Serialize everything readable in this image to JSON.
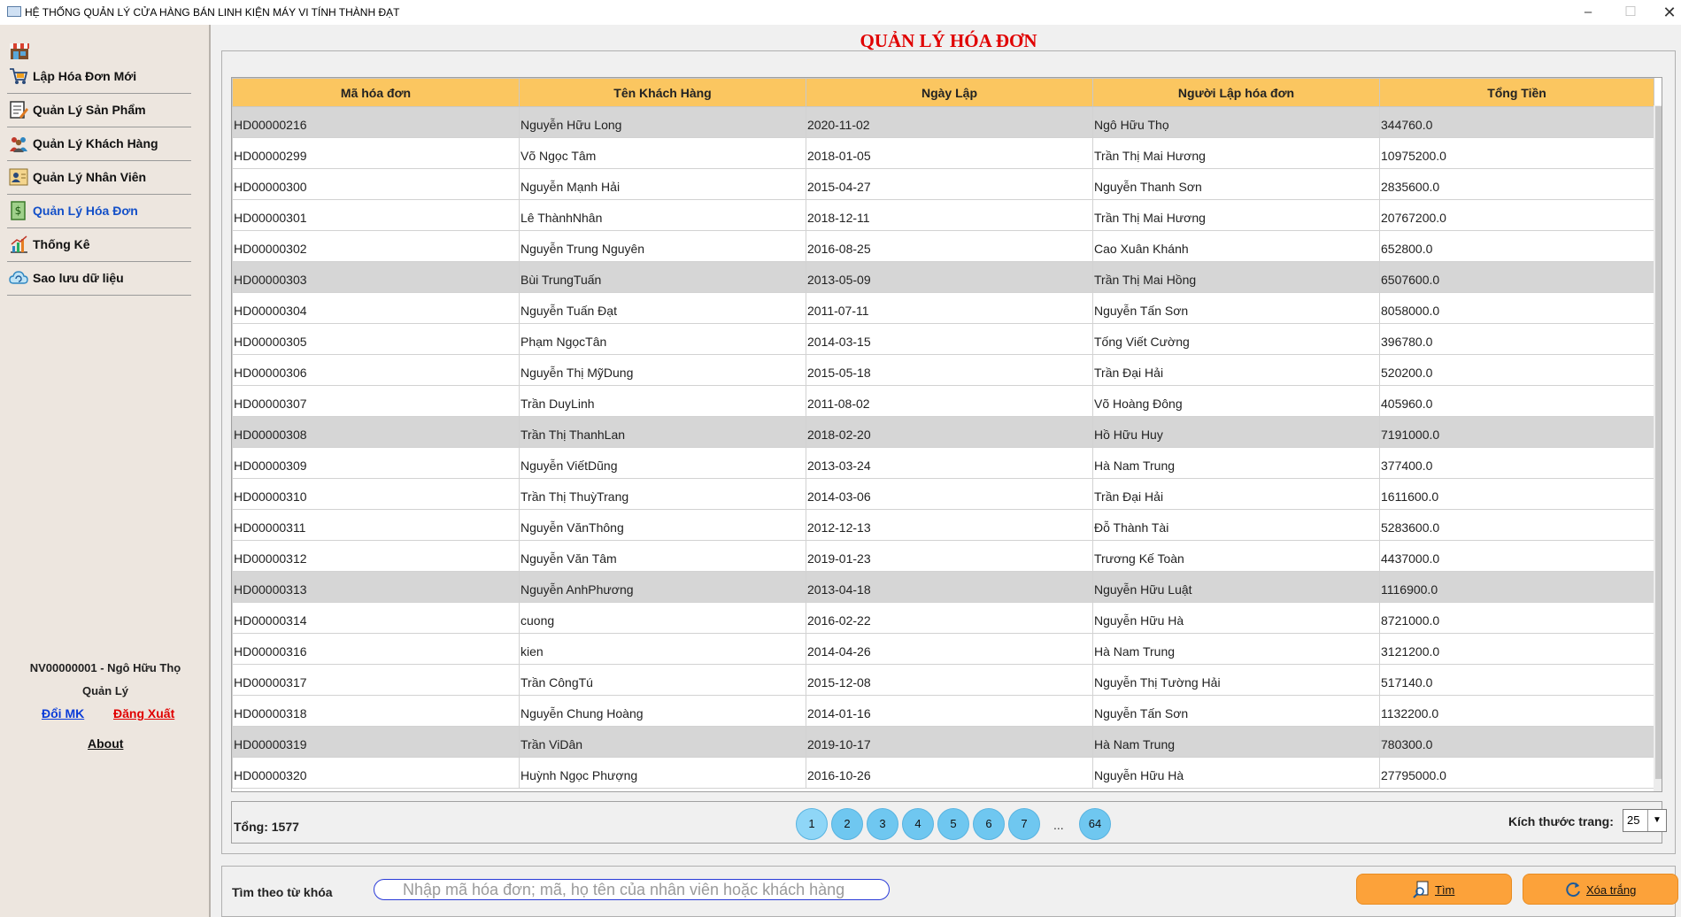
{
  "window": {
    "title": "HỆ THỐNG QUẢN LÝ CỬA HÀNG BÁN LINH KIỆN MÁY VI TÍNH THÀNH ĐẠT",
    "minimize": "–",
    "maximize": "☐",
    "close": "✕"
  },
  "sidebar": {
    "items": [
      {
        "label": "Lập Hóa Đơn Mới",
        "icon": "cart-icon"
      },
      {
        "label": "Quản Lý Sản Phẩm",
        "icon": "edit-list-icon"
      },
      {
        "label": "Quản Lý Khách Hàng",
        "icon": "customers-icon"
      },
      {
        "label": "Quản Lý Nhân Viên",
        "icon": "employee-icon"
      },
      {
        "label": "Quản Lý Hóa Đơn",
        "icon": "invoice-icon"
      },
      {
        "label": "Thống Kê",
        "icon": "chart-icon"
      },
      {
        "label": "Sao lưu dữ liệu",
        "icon": "backup-icon"
      }
    ],
    "active_index": 4,
    "user": "NV00000001 - Ngô Hữu  Thọ",
    "role": "Quản Lý",
    "change_password": "Đổi MK",
    "logout": "Đăng Xuất",
    "about": "About"
  },
  "main": {
    "title": "QUẢN LÝ HÓA ĐƠN",
    "columns": [
      "Mã hóa đơn",
      "Tên Khách Hàng",
      "Ngày Lập",
      "Người Lập hóa đơn",
      "Tổng Tiền"
    ],
    "rows": [
      [
        "HD00000216",
        "Nguyễn Hữu Long",
        "2020-11-02",
        "Ngô Hữu  Thọ",
        "344760.0"
      ],
      [
        "HD00000299",
        "Võ Ngọc Tâm",
        "2018-01-05",
        "Trần Thị Mai Hương",
        "10975200.0"
      ],
      [
        "HD00000300",
        "Nguyễn Mạnh Hải",
        "2015-04-27",
        "Nguyễn Thanh Sơn",
        "2835600.0"
      ],
      [
        "HD00000301",
        "Lê ThànhNhân",
        "2018-12-11",
        "Trần Thị Mai Hương",
        "20767200.0"
      ],
      [
        "HD00000302",
        "Nguyễn Trung Nguyên",
        "2016-08-25",
        "Cao Xuân  Khánh",
        "652800.0"
      ],
      [
        "HD00000303",
        "Bùi TrungTuấn",
        "2013-05-09",
        "Trần Thị Mai Hồng",
        "6507600.0"
      ],
      [
        "HD00000304",
        "Nguyễn Tuấn Đạt",
        "2011-07-11",
        "Nguyễn Tấn Sơn",
        "8058000.0"
      ],
      [
        "HD00000305",
        "Phạm NgọcTân",
        "2014-03-15",
        "Tống Viết Cường",
        "396780.0"
      ],
      [
        "HD00000306",
        "Nguyễn Thị MỹDung",
        "2015-05-18",
        "Trần Đại Hải",
        "520200.0"
      ],
      [
        "HD00000307",
        "Trần DuyLinh",
        "2011-08-02",
        "Võ Hoàng Đông",
        "405960.0"
      ],
      [
        "HD00000308",
        "Trần Thị ThanhLan",
        "2018-02-20",
        "Hồ Hữu  Huy",
        "7191000.0"
      ],
      [
        "HD00000309",
        "Nguyễn ViếtDũng",
        "2013-03-24",
        "Hà Nam  Trung",
        "377400.0"
      ],
      [
        "HD00000310",
        "Trần Thị ThuỳTrang",
        "2014-03-06",
        "Trần Đại Hải",
        "1611600.0"
      ],
      [
        "HD00000311",
        "Nguyễn VănThông",
        "2012-12-13",
        "Đỗ Thành Tài",
        "5283600.0"
      ],
      [
        "HD00000312",
        "Nguyễn Văn Tâm",
        "2019-01-23",
        "Trương Kế Toàn",
        "4437000.0"
      ],
      [
        "HD00000313",
        "Nguyễn AnhPhương",
        "2013-04-18",
        "Nguyễn Hữu Luật",
        "1116900.0"
      ],
      [
        "HD00000314",
        "cuong",
        "2016-02-22",
        "Nguyễn Hữu Hà",
        "8721000.0"
      ],
      [
        "HD00000316",
        "kien",
        "2014-04-26",
        "Hà Nam  Trung",
        "3121200.0"
      ],
      [
        "HD00000317",
        "Trần CôngTú",
        "2015-12-08",
        "Nguyễn Thị Tường Hải",
        "517140.0"
      ],
      [
        "HD00000318",
        "Nguyễn Chung Hoàng",
        "2014-01-16",
        "Nguyễn Tấn Sơn",
        "1132200.0"
      ],
      [
        "HD00000319",
        "Trần ViDân",
        "2019-10-17",
        "Hà Nam  Trung",
        "780300.0"
      ],
      [
        "HD00000320",
        "Huỳnh Ngọc Phượng",
        "2016-10-26",
        "Nguyễn Hữu Hà",
        "27795000.0"
      ]
    ],
    "highlighted_rows": [
      0,
      5,
      10,
      15,
      20
    ],
    "total_label": "Tổng: 1577",
    "pages": [
      "1",
      "2",
      "3",
      "4",
      "5",
      "6",
      "7"
    ],
    "current_page": "1",
    "ellipsis": "...",
    "last_page": "64",
    "page_size_label": "Kích thước trang:",
    "page_size": "25"
  },
  "search": {
    "label": "Tìm theo từ khóa",
    "placeholder": "Nhập mã hóa đơn; mã, họ tên của nhân viên hoặc khách hàng",
    "find_button": "Tìm",
    "clear_button": "Xóa trắng"
  },
  "colors": {
    "title_red": "#e00000",
    "header_orange": "#fbc660",
    "active_blue": "#1450c8",
    "button_orange": "#fca23a",
    "page_button": "#6fc7f0"
  }
}
